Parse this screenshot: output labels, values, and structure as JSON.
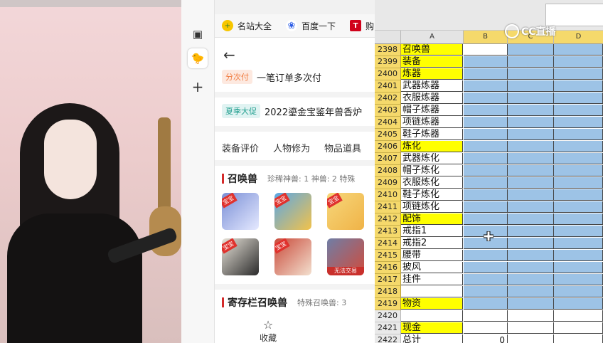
{
  "browser": {
    "bookmarks": [
      {
        "label": "名站大全",
        "icon": "plus-circle-icon",
        "color": "#2e7d32"
      },
      {
        "label": "百度一下",
        "icon": "paw-icon",
        "color": "#2b5ce6"
      },
      {
        "label": "购",
        "icon": "t-logo-icon",
        "color": "#d0021b"
      }
    ],
    "promos": [
      {
        "tag": "分次付",
        "text": "一笔订单多次付"
      },
      {
        "tag": "夏季大促",
        "text": "2022鎏金宝鉴年兽香炉"
      }
    ],
    "tabs": [
      "装备评价",
      "人物修为",
      "物品道具"
    ],
    "pets_section": {
      "title": "召唤兽",
      "stats": "珍稀神兽: 1   神兽: 2   特殊"
    },
    "pet_badge": "宝宝",
    "pet_lock": "无法交易",
    "stash_section": {
      "title": "寄存栏召唤兽",
      "stats": "特殊召唤兽: 3"
    },
    "fav_label": "收藏"
  },
  "excel": {
    "columns": [
      "A",
      "B",
      "C",
      "D"
    ],
    "rows": [
      {
        "num": "2398",
        "a": "召唤兽",
        "yellow": true
      },
      {
        "num": "2399",
        "a": "装备",
        "yellow": true
      },
      {
        "num": "2400",
        "a": "炼器",
        "yellow": true
      },
      {
        "num": "2401",
        "a": "武器炼器",
        "yellow": false
      },
      {
        "num": "2402",
        "a": "衣服炼器",
        "yellow": false
      },
      {
        "num": "2403",
        "a": "帽子炼器",
        "yellow": false
      },
      {
        "num": "2404",
        "a": "项链炼器",
        "yellow": false
      },
      {
        "num": "2405",
        "a": "鞋子炼器",
        "yellow": false
      },
      {
        "num": "2406",
        "a": "炼化",
        "yellow": true
      },
      {
        "num": "2407",
        "a": "武器炼化",
        "yellow": false
      },
      {
        "num": "2408",
        "a": "帽子炼化",
        "yellow": false
      },
      {
        "num": "2409",
        "a": "衣服炼化",
        "yellow": false
      },
      {
        "num": "2410",
        "a": "鞋子炼化",
        "yellow": false
      },
      {
        "num": "2411",
        "a": "项链炼化",
        "yellow": false
      },
      {
        "num": "2412",
        "a": "配饰",
        "yellow": true
      },
      {
        "num": "2413",
        "a": "戒指1",
        "yellow": false
      },
      {
        "num": "2414",
        "a": "戒指2",
        "yellow": false
      },
      {
        "num": "2415",
        "a": "腰带",
        "yellow": false
      },
      {
        "num": "2416",
        "a": "披风",
        "yellow": false
      },
      {
        "num": "2417",
        "a": "挂件",
        "yellow": false
      },
      {
        "num": "2418",
        "a": "",
        "yellow": false
      },
      {
        "num": "2419",
        "a": "物资",
        "yellow": true
      },
      {
        "num": "2420",
        "a": "",
        "yellow": false
      },
      {
        "num": "2421",
        "a": "现金",
        "yellow": true
      },
      {
        "num": "2422",
        "a": "总计",
        "yellow": false,
        "b": "0"
      },
      {
        "num": "2423",
        "a": "",
        "yellow": false
      }
    ]
  },
  "watermark": "CC直播",
  "colors": {
    "selection": "#9dc3e6",
    "highlight": "#ffff00",
    "header_sel": "#f5d96b"
  }
}
